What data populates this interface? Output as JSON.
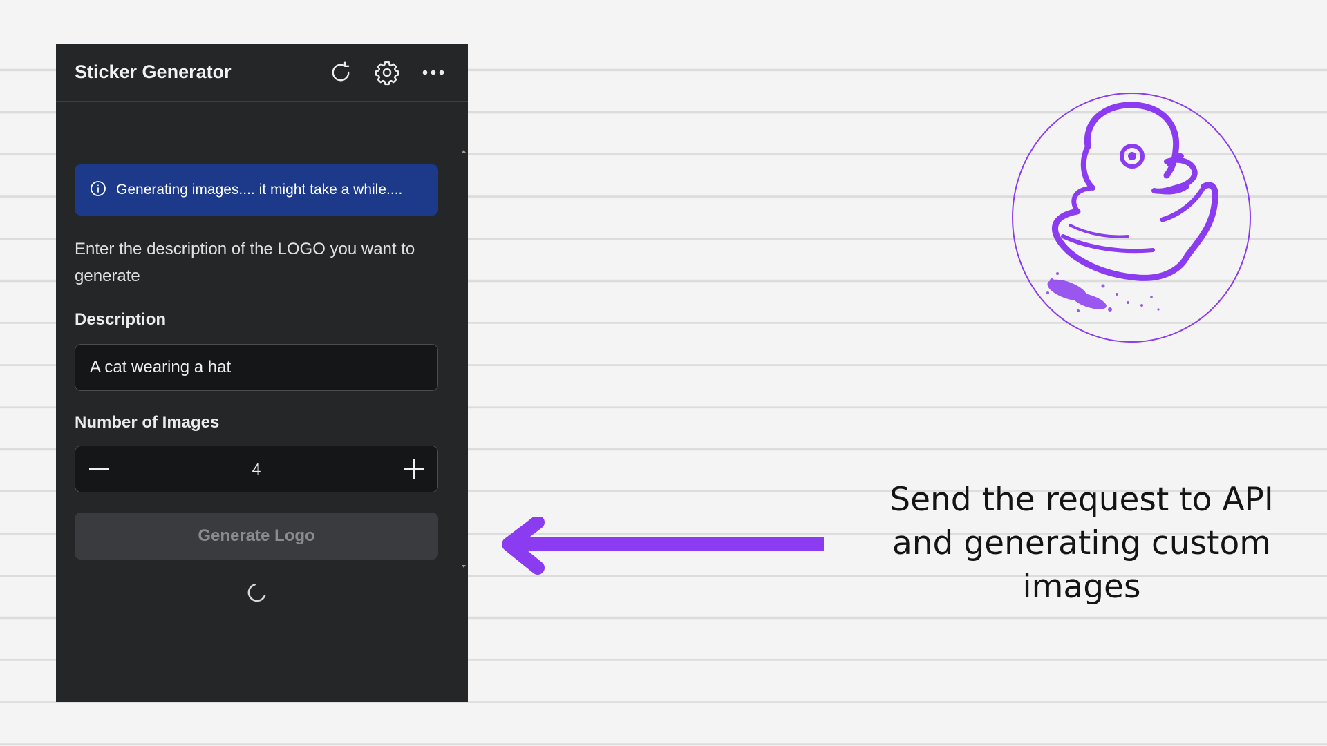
{
  "panel": {
    "title": "Sticker Generator",
    "header_icons": [
      "refresh-icon",
      "gear-icon",
      "more-icon"
    ],
    "alert": {
      "icon": "info-icon",
      "text": "Generating images.... it might take a while...."
    },
    "intro": "Enter the description of the LOGO you want to generate",
    "description": {
      "label": "Description",
      "value": "A cat wearing a hat"
    },
    "number_of_images": {
      "label": "Number of Images",
      "value": "4"
    },
    "generate_button": "Generate Logo",
    "loading": true
  },
  "annotation": {
    "caption": "Send the request to API and generating custom images",
    "arrow_color": "#8b3cf0"
  },
  "logo": {
    "icon": "duck-logo",
    "color": "#8b3cf0"
  },
  "colors": {
    "panel_bg": "#252628",
    "alert_bg": "#1d3a8a",
    "accent": "#8b3cf0"
  }
}
